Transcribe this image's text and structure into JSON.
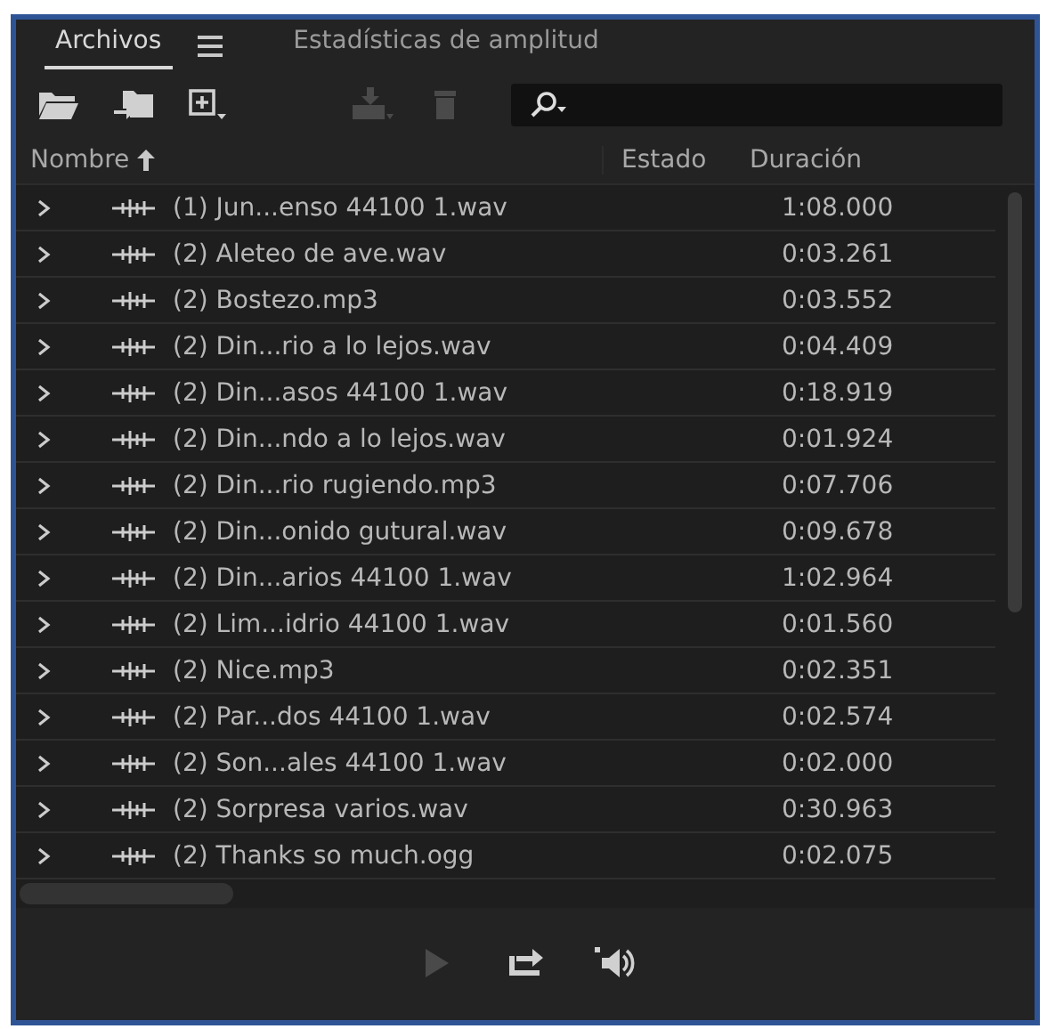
{
  "tabs": [
    {
      "label": "Archivos",
      "selected": true
    },
    {
      "label": "Estadísticas de amplitud",
      "selected": false
    }
  ],
  "toolbar": [
    {
      "kind": "open-folder",
      "disabled": false
    },
    {
      "kind": "import-folder",
      "disabled": false
    },
    {
      "kind": "new",
      "disabled": false
    },
    {
      "kind": "insert",
      "disabled": true
    },
    {
      "kind": "delete",
      "disabled": true
    }
  ],
  "columns": [
    {
      "label": "Nombre",
      "sorted": true
    },
    {
      "label": "Estado"
    },
    {
      "label": "Duración"
    }
  ],
  "rows": [
    {
      "name": "(1) Jun...enso 44100 1.wav",
      "duration": "1:08.000"
    },
    {
      "name": "(2) Aleteo de ave.wav",
      "duration": "0:03.261"
    },
    {
      "name": "(2) Bostezo.mp3",
      "duration": "0:03.552"
    },
    {
      "name": "(2) Din...rio a lo lejos.wav",
      "duration": "0:04.409"
    },
    {
      "name": "(2) Din...asos 44100 1.wav",
      "duration": "0:18.919"
    },
    {
      "name": "(2) Din...ndo a lo lejos.wav",
      "duration": "0:01.924"
    },
    {
      "name": "(2) Din...rio rugiendo.mp3",
      "duration": "0:07.706"
    },
    {
      "name": "(2) Din...onido gutural.wav",
      "duration": "0:09.678"
    },
    {
      "name": "(2) Din...arios 44100 1.wav",
      "duration": "1:02.964"
    },
    {
      "name": "(2) Lim...idrio 44100 1.wav",
      "duration": "0:01.560"
    },
    {
      "name": "(2) Nice.mp3",
      "duration": "0:02.351"
    },
    {
      "name": "(2) Par...dos 44100 1.wav",
      "duration": "0:02.574"
    },
    {
      "name": "(2) Son...ales 44100 1.wav",
      "duration": "0:02.000"
    },
    {
      "name": "(2) Sorpresa varios.wav",
      "duration": "0:30.963"
    },
    {
      "name": "(2) Thanks so much.ogg",
      "duration": "0:02.075"
    }
  ],
  "transport": [
    {
      "kind": "play",
      "disabled": true
    },
    {
      "kind": "loop",
      "disabled": false
    },
    {
      "kind": "autoplay",
      "disabled": false
    }
  ]
}
